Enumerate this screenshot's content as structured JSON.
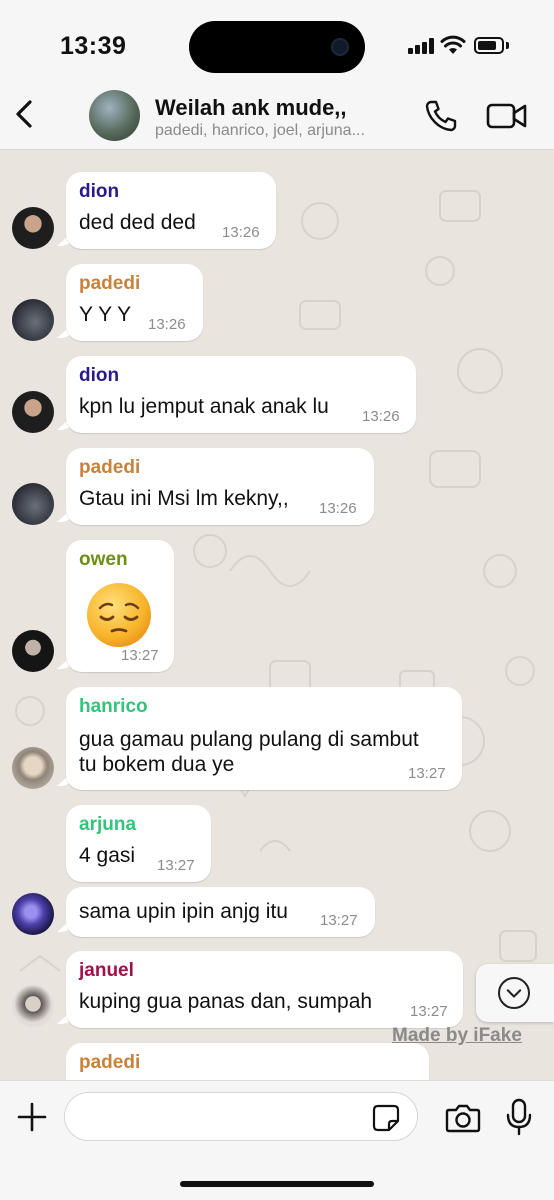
{
  "status": {
    "time": "13:39"
  },
  "header": {
    "title": "Weilah ank mude,,",
    "members": "padedi, hanrico, joel, arjuna..."
  },
  "messages": [
    {
      "sender": "dion",
      "sender_color": "#2b1b8a",
      "text": "ded ded ded",
      "time": "13:26"
    },
    {
      "sender": "padedi",
      "sender_color": "#c8823a",
      "text": "Y Y Y",
      "time": "13:26"
    },
    {
      "sender": "dion",
      "sender_color": "#2b1b8a",
      "text": "kpn lu jemput anak anak lu",
      "time": "13:26"
    },
    {
      "sender": "padedi",
      "sender_color": "#c8823a",
      "text": "Gtau ini Msi lm kekny,,",
      "time": "13:26"
    },
    {
      "sender": "owen",
      "sender_color": "#6e8f13",
      "emoji": "pensive-face",
      "time": "13:27"
    },
    {
      "sender": "hanrico",
      "sender_color": "#33c37a",
      "text_lines": [
        "gua gamau pulang pulang di sambut",
        "tu bokem dua ye"
      ],
      "time": "13:27"
    },
    {
      "sender": "arjuna",
      "sender_color": "#33c37a",
      "text": "4 gasi",
      "time": "13:27"
    },
    {
      "text": "sama upin ipin anjg itu",
      "time": "13:27"
    },
    {
      "sender": "januel",
      "sender_color": "#a0114a",
      "text": "kuping gua panas dan, sumpah",
      "time": "13:27"
    },
    {
      "sender": "padedi",
      "sender_color": "#c8823a"
    }
  ],
  "watermark": "Made by iFake",
  "input": {
    "placeholder": ""
  }
}
